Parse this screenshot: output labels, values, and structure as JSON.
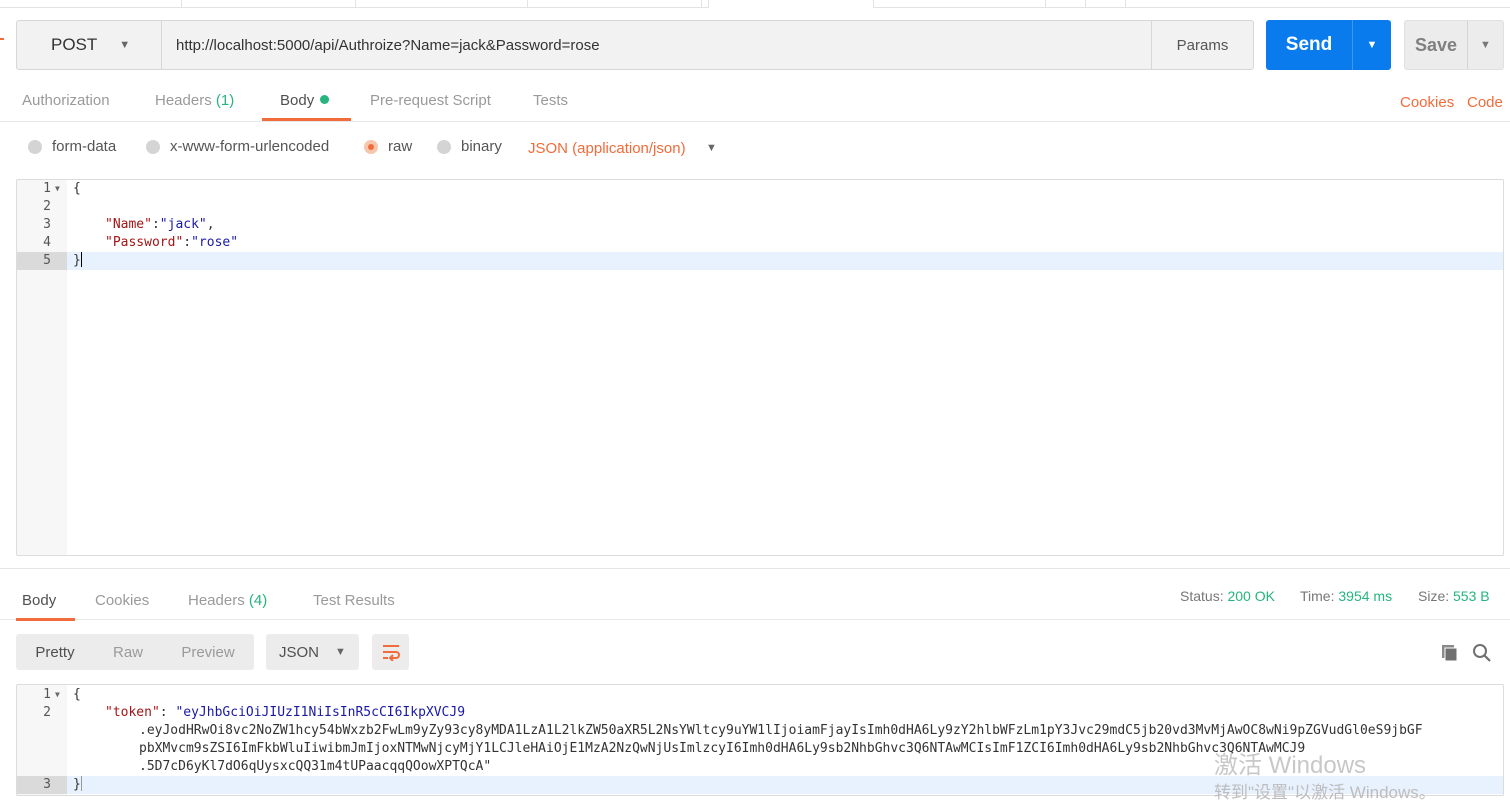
{
  "request": {
    "method": "POST",
    "url": "http://localhost:5000/api/Authroize?Name=jack&Password=rose",
    "params_label": "Params",
    "send_label": "Send",
    "save_label": "Save"
  },
  "request_tabs": {
    "authorization": "Authorization",
    "headers": "Headers",
    "headers_count": "(1)",
    "body": "Body",
    "prerequest": "Pre-request Script",
    "tests": "Tests",
    "cookies": "Cookies",
    "code": "Code"
  },
  "body_types": {
    "form_data": "form-data",
    "urlencoded": "x-www-form-urlencoded",
    "raw": "raw",
    "binary": "binary",
    "content_type": "JSON (application/json)"
  },
  "request_body": {
    "line_numbers": [
      "1",
      "2",
      "3",
      "4",
      "5"
    ],
    "line1": "{",
    "line3_key": "\"Name\"",
    "line3_sep": ":",
    "line3_val": "\"jack\"",
    "line3_end": ",",
    "line4_key": "\"Password\"",
    "line4_sep": ":",
    "line4_val": "\"rose\"",
    "line5": "}"
  },
  "response_tabs": {
    "body": "Body",
    "cookies": "Cookies",
    "headers": "Headers",
    "headers_count": "(4)",
    "test_results": "Test Results"
  },
  "response_status": {
    "status_label": "Status:",
    "status_value": "200 OK",
    "time_label": "Time:",
    "time_value": "3954 ms",
    "size_label": "Size:",
    "size_value": "553 B"
  },
  "response_view": {
    "pretty": "Pretty",
    "raw": "Raw",
    "preview": "Preview",
    "format": "JSON"
  },
  "response_body": {
    "line_numbers": [
      "1",
      "2",
      "3"
    ],
    "line1": "{",
    "token_key": "\"token\"",
    "token_sep": ": ",
    "token_part1": "\"eyJhbGciOiJIUzI1NiIsInR5cCI6IkpXVCJ9",
    "token_part2": ".eyJodHRwOi8vc2NoZW1hcy54bWxzb2FwLm9yZy93cy8yMDA1LzA1L2lkZW50aXR5L2NsYWltcy9uYW1lIjoiamFjayIsImh0dHA6Ly9zY2hlbWFzLm1pY3Jvc29mdC5jb20vd3MvMjAwOC8wNi9pZGVudGl0eS9jbGF",
    "token_part3": "pbXMvcm9sZSI6ImFkbWluIiwibmJmIjoxNTMwNjcyMjY1LCJleHAiOjE1MzA2NzQwNjUsImlzcyI6Imh0dHA6Ly9sb2NhbGhvc3Q6NTAwMCIsImF1ZCI6Imh0dHA6Ly9sb2NhbGhvc3Q6NTAwMCJ9",
    "token_part4": ".5D7cD6yKl7dO6qUysxcQQ31m4tUPaacqqQOowXPTQcA\"",
    "line3": "}"
  },
  "watermark": {
    "line1": "激活 Windows",
    "line2": "转到\"设置\"以激活 Windows。"
  },
  "colors": {
    "accent": "#f26b3a",
    "send_blue": "#097bed",
    "status_green": "#26b47f"
  }
}
